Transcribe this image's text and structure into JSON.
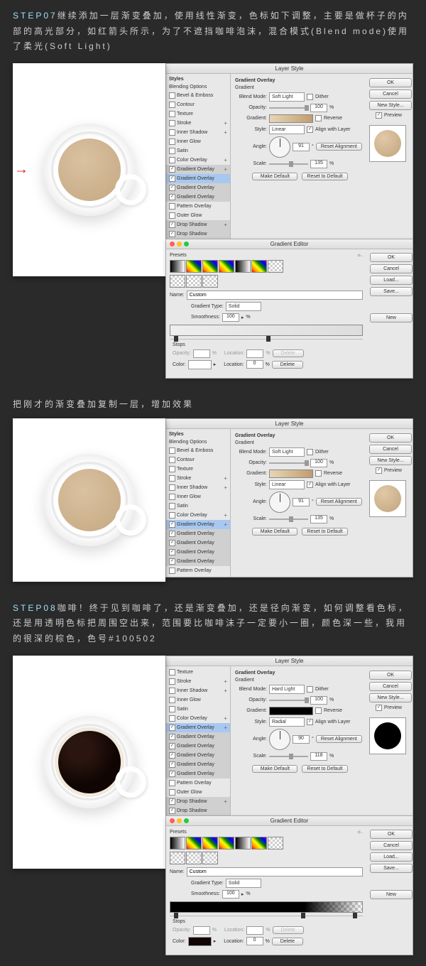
{
  "step07": {
    "label": "STEP07",
    "text": "继续添加一层渐变叠加，使用线性渐变，色标如下调整，主要是做杯子的内部的高光部分，如红箭头所示，为了不遮挡咖啡泡沫，混合模式(Blend mode)使用了柔光(Soft Light)"
  },
  "midtext": "把刚才的渐变叠加复制一层，增加效果",
  "step08": {
    "label": "STEP08",
    "text": "咖啡！终于见到咖啡了，还是渐变叠加，还是径向渐变，如何调整看色标，还是用透明色标把周围空出来，范围要比咖啡沫子一定要小一圈，颜色深一些，我用的很深的棕色，色号#100502"
  },
  "layerStyle": {
    "title": "Layer Style",
    "stylesHeader": "Styles",
    "blendingOptions": "Blending Options",
    "items": {
      "bevelEmboss": "Bevel & Emboss",
      "contour": "Contour",
      "texture": "Texture",
      "stroke": "Stroke",
      "innerShadow": "Inner Shadow",
      "innerGlow": "Inner Glow",
      "satin": "Satin",
      "colorOverlay": "Color Overlay",
      "gradientOverlay": "Gradient Overlay",
      "patternOverlay": "Pattern Overlay",
      "outerGlow": "Outer Glow",
      "dropShadow": "Drop Shadow"
    },
    "panel": {
      "title": "Gradient Overlay",
      "subtitle": "Gradient",
      "blendMode": "Blend Mode:",
      "softLight": "Soft Light",
      "hardLight": "Hard Light",
      "dither": "Dither",
      "opacity": "Opacity:",
      "opacityVal": "100",
      "pct": "%",
      "gradient": "Gradient:",
      "reverse": "Reverse",
      "style": "Style:",
      "linear": "Linear",
      "radial": "Radial",
      "alignWithLayer": "Align with Layer",
      "angle": "Angle:",
      "angleVal1": "91",
      "angleVal2": "90",
      "deg": "°",
      "resetAlign": "Reset Alignment",
      "scale": "Scale:",
      "scaleVal1": "135",
      "scaleVal2": "118",
      "makeDefault": "Make Default",
      "resetDefault": "Reset to Default"
    },
    "buttons": {
      "ok": "OK",
      "cancel": "Cancel",
      "newStyle": "New Style...",
      "preview": "Preview"
    }
  },
  "gradEditor": {
    "title": "Gradient Editor",
    "presets": "Presets",
    "gear": "☼.",
    "name": "Name:",
    "nameVal": "Custom",
    "gradType": "Gradient Type:",
    "solid": "Solid",
    "smoothness": "Smoothness:",
    "smoothVal": "100",
    "pct": "%",
    "stops": "Stops",
    "opacityLbl": "Opacity:",
    "locationLbl": "Location:",
    "locVal": "0",
    "colorLbl": "Color:",
    "delete": "Delete",
    "ok": "OK",
    "cancel": "Cancel",
    "load": "Load...",
    "save": "Save...",
    "new": "New"
  }
}
